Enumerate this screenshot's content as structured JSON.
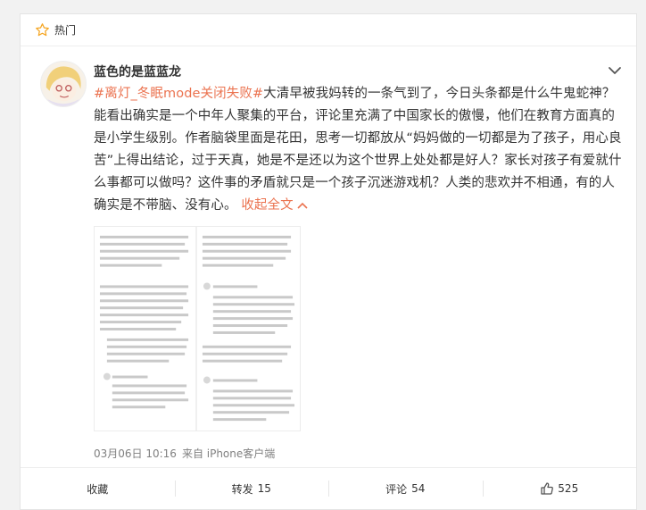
{
  "header": {
    "hot_label": "热门"
  },
  "post": {
    "nickname": "蓝色的是蓝蓝龙",
    "topic": "#离灯_冬眠mode关闭失败#",
    "text": "大清早被我妈转的一条气到了，今日头条都是什么牛鬼蛇神？能看出确实是一个中年人聚集的平台，评论里充满了中国家长的傲慢，他们在教育方面真的是小学生级别。作者脑袋里面是花田，思考一切都放从“妈妈做的一切都是为了孩子，用心良苦”上得出结论，过于天真，她是不是还以为这个世界上处处都是好人？家长对孩子有爱就什么事都可以做吗？这件事的矛盾就只是一个孩子沉迷游戏机？人类的悲欢并不相通，有的人确实是不带脑、没有心。",
    "collapse_label": "收起全文",
    "date": "03月06日 10:16",
    "source": "来自 iPhone客户端"
  },
  "actions": {
    "favorite_label": "收藏",
    "repost_label": "转发",
    "repost_count": "15",
    "comment_label": "评论",
    "comment_count": "54",
    "like_count": "525"
  },
  "theme": {
    "accent": "#eb7350",
    "star": "#f5a623",
    "meta": "#808080"
  }
}
